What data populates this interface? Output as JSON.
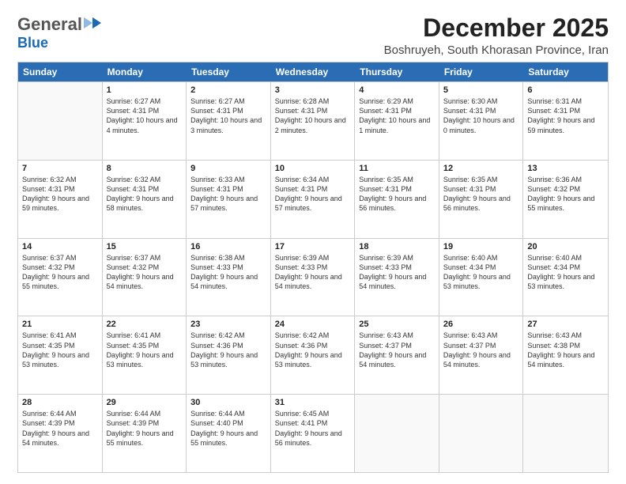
{
  "header": {
    "logo_general": "General",
    "logo_blue": "Blue",
    "month": "December 2025",
    "location": "Boshruyeh, South Khorasan Province, Iran"
  },
  "weekdays": [
    "Sunday",
    "Monday",
    "Tuesday",
    "Wednesday",
    "Thursday",
    "Friday",
    "Saturday"
  ],
  "weeks": [
    [
      {
        "day": "",
        "empty": true
      },
      {
        "day": "1",
        "sunrise": "Sunrise: 6:27 AM",
        "sunset": "Sunset: 4:31 PM",
        "daylight": "Daylight: 10 hours and 4 minutes."
      },
      {
        "day": "2",
        "sunrise": "Sunrise: 6:27 AM",
        "sunset": "Sunset: 4:31 PM",
        "daylight": "Daylight: 10 hours and 3 minutes."
      },
      {
        "day": "3",
        "sunrise": "Sunrise: 6:28 AM",
        "sunset": "Sunset: 4:31 PM",
        "daylight": "Daylight: 10 hours and 2 minutes."
      },
      {
        "day": "4",
        "sunrise": "Sunrise: 6:29 AM",
        "sunset": "Sunset: 4:31 PM",
        "daylight": "Daylight: 10 hours and 1 minute."
      },
      {
        "day": "5",
        "sunrise": "Sunrise: 6:30 AM",
        "sunset": "Sunset: 4:31 PM",
        "daylight": "Daylight: 10 hours and 0 minutes."
      },
      {
        "day": "6",
        "sunrise": "Sunrise: 6:31 AM",
        "sunset": "Sunset: 4:31 PM",
        "daylight": "Daylight: 9 hours and 59 minutes."
      }
    ],
    [
      {
        "day": "7",
        "sunrise": "Sunrise: 6:32 AM",
        "sunset": "Sunset: 4:31 PM",
        "daylight": "Daylight: 9 hours and 59 minutes."
      },
      {
        "day": "8",
        "sunrise": "Sunrise: 6:32 AM",
        "sunset": "Sunset: 4:31 PM",
        "daylight": "Daylight: 9 hours and 58 minutes."
      },
      {
        "day": "9",
        "sunrise": "Sunrise: 6:33 AM",
        "sunset": "Sunset: 4:31 PM",
        "daylight": "Daylight: 9 hours and 57 minutes."
      },
      {
        "day": "10",
        "sunrise": "Sunrise: 6:34 AM",
        "sunset": "Sunset: 4:31 PM",
        "daylight": "Daylight: 9 hours and 57 minutes."
      },
      {
        "day": "11",
        "sunrise": "Sunrise: 6:35 AM",
        "sunset": "Sunset: 4:31 PM",
        "daylight": "Daylight: 9 hours and 56 minutes."
      },
      {
        "day": "12",
        "sunrise": "Sunrise: 6:35 AM",
        "sunset": "Sunset: 4:31 PM",
        "daylight": "Daylight: 9 hours and 56 minutes."
      },
      {
        "day": "13",
        "sunrise": "Sunrise: 6:36 AM",
        "sunset": "Sunset: 4:32 PM",
        "daylight": "Daylight: 9 hours and 55 minutes."
      }
    ],
    [
      {
        "day": "14",
        "sunrise": "Sunrise: 6:37 AM",
        "sunset": "Sunset: 4:32 PM",
        "daylight": "Daylight: 9 hours and 55 minutes."
      },
      {
        "day": "15",
        "sunrise": "Sunrise: 6:37 AM",
        "sunset": "Sunset: 4:32 PM",
        "daylight": "Daylight: 9 hours and 54 minutes."
      },
      {
        "day": "16",
        "sunrise": "Sunrise: 6:38 AM",
        "sunset": "Sunset: 4:33 PM",
        "daylight": "Daylight: 9 hours and 54 minutes."
      },
      {
        "day": "17",
        "sunrise": "Sunrise: 6:39 AM",
        "sunset": "Sunset: 4:33 PM",
        "daylight": "Daylight: 9 hours and 54 minutes."
      },
      {
        "day": "18",
        "sunrise": "Sunrise: 6:39 AM",
        "sunset": "Sunset: 4:33 PM",
        "daylight": "Daylight: 9 hours and 54 minutes."
      },
      {
        "day": "19",
        "sunrise": "Sunrise: 6:40 AM",
        "sunset": "Sunset: 4:34 PM",
        "daylight": "Daylight: 9 hours and 53 minutes."
      },
      {
        "day": "20",
        "sunrise": "Sunrise: 6:40 AM",
        "sunset": "Sunset: 4:34 PM",
        "daylight": "Daylight: 9 hours and 53 minutes."
      }
    ],
    [
      {
        "day": "21",
        "sunrise": "Sunrise: 6:41 AM",
        "sunset": "Sunset: 4:35 PM",
        "daylight": "Daylight: 9 hours and 53 minutes."
      },
      {
        "day": "22",
        "sunrise": "Sunrise: 6:41 AM",
        "sunset": "Sunset: 4:35 PM",
        "daylight": "Daylight: 9 hours and 53 minutes."
      },
      {
        "day": "23",
        "sunrise": "Sunrise: 6:42 AM",
        "sunset": "Sunset: 4:36 PM",
        "daylight": "Daylight: 9 hours and 53 minutes."
      },
      {
        "day": "24",
        "sunrise": "Sunrise: 6:42 AM",
        "sunset": "Sunset: 4:36 PM",
        "daylight": "Daylight: 9 hours and 53 minutes."
      },
      {
        "day": "25",
        "sunrise": "Sunrise: 6:43 AM",
        "sunset": "Sunset: 4:37 PM",
        "daylight": "Daylight: 9 hours and 54 minutes."
      },
      {
        "day": "26",
        "sunrise": "Sunrise: 6:43 AM",
        "sunset": "Sunset: 4:37 PM",
        "daylight": "Daylight: 9 hours and 54 minutes."
      },
      {
        "day": "27",
        "sunrise": "Sunrise: 6:43 AM",
        "sunset": "Sunset: 4:38 PM",
        "daylight": "Daylight: 9 hours and 54 minutes."
      }
    ],
    [
      {
        "day": "28",
        "sunrise": "Sunrise: 6:44 AM",
        "sunset": "Sunset: 4:39 PM",
        "daylight": "Daylight: 9 hours and 54 minutes."
      },
      {
        "day": "29",
        "sunrise": "Sunrise: 6:44 AM",
        "sunset": "Sunset: 4:39 PM",
        "daylight": "Daylight: 9 hours and 55 minutes."
      },
      {
        "day": "30",
        "sunrise": "Sunrise: 6:44 AM",
        "sunset": "Sunset: 4:40 PM",
        "daylight": "Daylight: 9 hours and 55 minutes."
      },
      {
        "day": "31",
        "sunrise": "Sunrise: 6:45 AM",
        "sunset": "Sunset: 4:41 PM",
        "daylight": "Daylight: 9 hours and 56 minutes."
      },
      {
        "day": "",
        "empty": true
      },
      {
        "day": "",
        "empty": true
      },
      {
        "day": "",
        "empty": true
      }
    ]
  ]
}
